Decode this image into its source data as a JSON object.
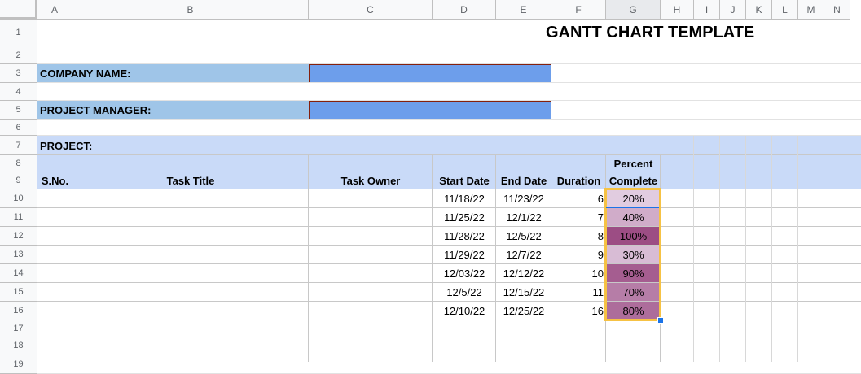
{
  "columns": [
    "A",
    "B",
    "C",
    "D",
    "E",
    "F",
    "G",
    "H",
    "I",
    "J",
    "K",
    "L",
    "M",
    "N"
  ],
  "rows": [
    "1",
    "2",
    "3",
    "4",
    "5",
    "6",
    "7",
    "8",
    "9",
    "10",
    "11",
    "12",
    "13",
    "14",
    "15",
    "16",
    "17",
    "18",
    "19"
  ],
  "title": "GANTT CHART TEMPLATE",
  "company_label": "COMPANY NAME:",
  "manager_label": "PROJECT MANAGER:",
  "project_label": "PROJECT:",
  "headers": {
    "sno": "S.No.",
    "task_title": "Task Title",
    "task_owner": "Task Owner",
    "start_date": "Start Date",
    "end_date": "End Date",
    "duration": "Duration",
    "percent_line1": "Percent",
    "percent_line2": "Complete"
  },
  "tasks": [
    {
      "start": "11/18/22",
      "end": "11/23/22",
      "duration": "6",
      "percent": "20%",
      "percent_value": 20
    },
    {
      "start": "11/25/22",
      "end": "12/1/22",
      "duration": "7",
      "percent": "40%",
      "percent_value": 40
    },
    {
      "start": "11/28/22",
      "end": "12/5/22",
      "duration": "8",
      "percent": "100%",
      "percent_value": 100
    },
    {
      "start": "11/29/22",
      "end": "12/7/22",
      "duration": "9",
      "percent": "30%",
      "percent_value": 30
    },
    {
      "start": "12/03/22",
      "end": "12/12/22",
      "duration": "10",
      "percent": "90%",
      "percent_value": 90
    },
    {
      "start": "12/5/22",
      "end": "12/15/22",
      "duration": "11",
      "percent": "70%",
      "percent_value": 70
    },
    {
      "start": "12/10/22",
      "end": "12/25/22",
      "duration": "16",
      "percent": "80%",
      "percent_value": 80
    }
  ],
  "colors": {
    "label_fill": "#9fc5e8",
    "input_fill": "#6d9eeb",
    "input_border": "#85200c",
    "header_fill": "#c9daf8",
    "selection_border": "#f6c244",
    "percent_low": "#e1cce0",
    "percent_high": "#9c4d84"
  }
}
